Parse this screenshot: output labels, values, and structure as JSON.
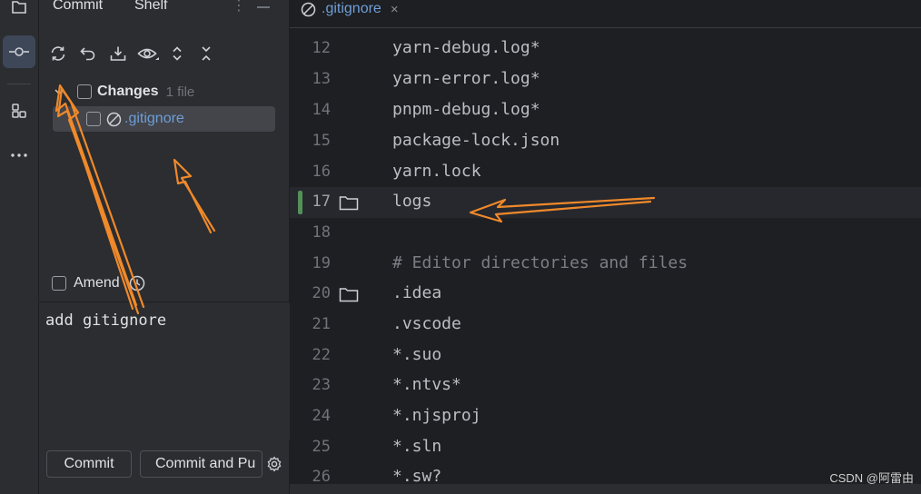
{
  "panel": {
    "tabs": [
      "Commit",
      "Shelf"
    ],
    "changes_label": "Changes",
    "changes_count": "1 file",
    "file_name": ".gitignore",
    "amend_label": "Amend",
    "commit_message": "add gitignore",
    "commit_button": "Commit",
    "commit_push_button": "Commit and Pu"
  },
  "toolbar_icons": [
    "refresh-icon",
    "rollback-icon",
    "shelve-icon",
    "eye-icon",
    "expand-icon",
    "collapse-icon"
  ],
  "editor": {
    "tab_name": ".gitignore",
    "tab_close": "×",
    "lines": [
      {
        "n": "12",
        "text": "yarn-debug.log*"
      },
      {
        "n": "13",
        "text": "yarn-error.log*"
      },
      {
        "n": "14",
        "text": "pnpm-debug.log*"
      },
      {
        "n": "15",
        "text": "package-lock.json"
      },
      {
        "n": "16",
        "text": "yarn.lock"
      },
      {
        "n": "17",
        "text": "logs"
      },
      {
        "n": "18",
        "text": ""
      },
      {
        "n": "19",
        "text": "# Editor directories and files"
      },
      {
        "n": "20",
        "text": ".idea"
      },
      {
        "n": "21",
        "text": ".vscode"
      },
      {
        "n": "22",
        "text": "*.suo"
      },
      {
        "n": "23",
        "text": "*.ntvs*"
      },
      {
        "n": "24",
        "text": "*.njsproj"
      },
      {
        "n": "25",
        "text": "*.sln"
      },
      {
        "n": "26",
        "text": "*.sw?"
      }
    ]
  },
  "watermark": "CSDN @阿雷由",
  "colors": {
    "accent_file": "#6f9ed8",
    "annotation_arrow": "#f0892a",
    "modified_marker": "#549159"
  }
}
